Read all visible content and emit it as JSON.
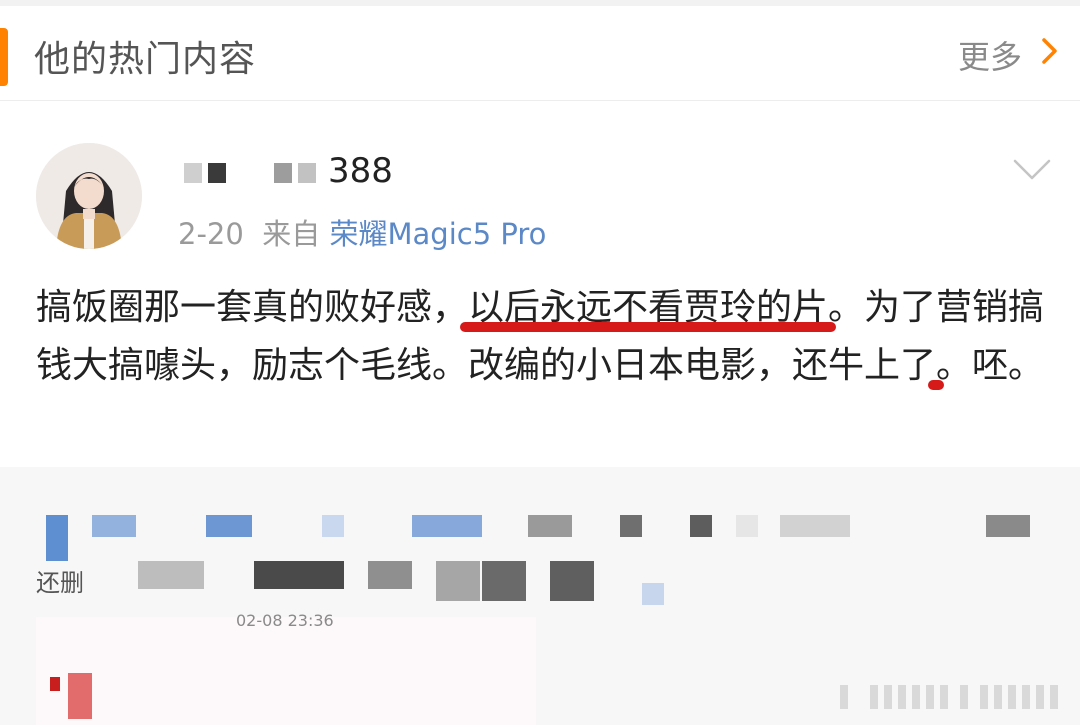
{
  "header": {
    "title": "他的热门内容",
    "more_label": "更多",
    "more_icon": "chevron-right-icon"
  },
  "post": {
    "username_visible": "388",
    "date": "2-20",
    "from_label": "来自",
    "device": "荣耀Magic5 Pro",
    "menu_icon": "chevron-down-icon",
    "text_parts": [
      "搞饭圈那一套真的败好感，",
      "以后永远不看贾玲的片",
      "。为了",
      "营销搞钱大搞噱",
      "头，励志个毛线。改编的小日本电影，还牛上了。呸。"
    ]
  },
  "comment": {
    "partial_text": "还删",
    "timestamp": "02-08 23:36"
  },
  "colors": {
    "accent": "#ff8200",
    "link": "#5b88c7",
    "underline": "#d61a1a"
  }
}
